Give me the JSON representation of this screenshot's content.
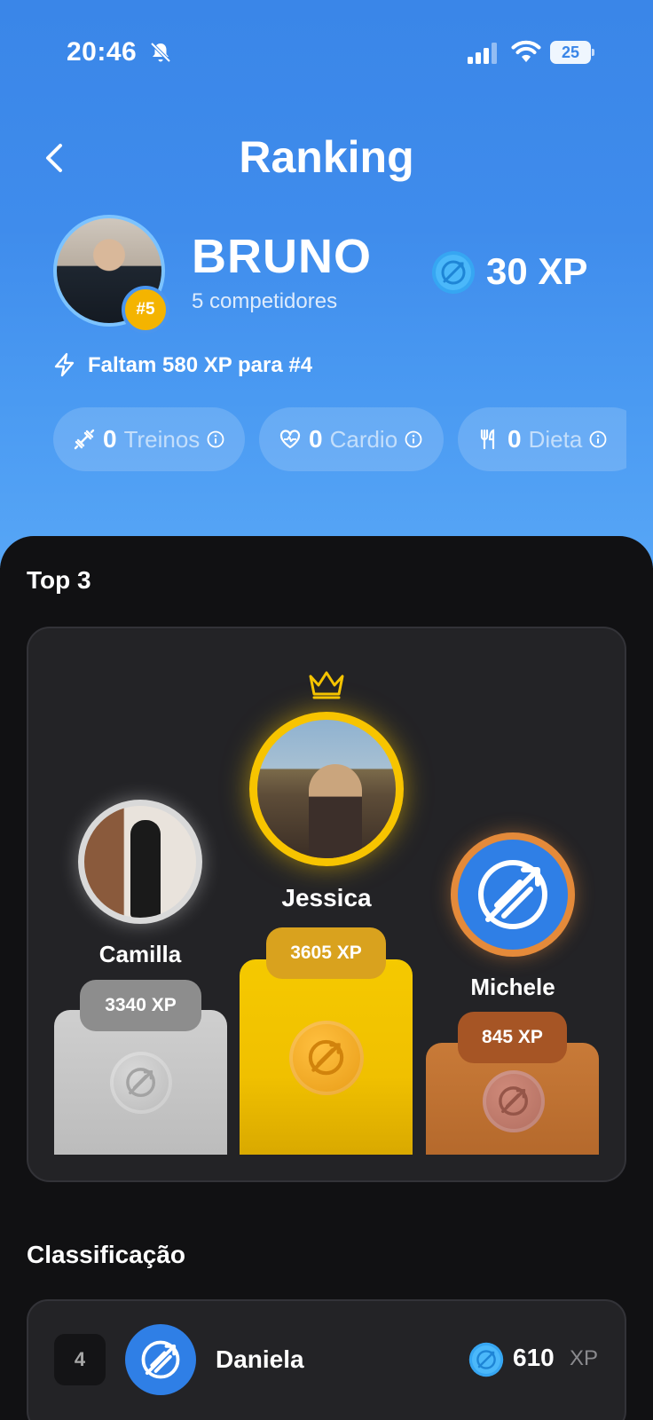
{
  "status_bar": {
    "time": "20:46",
    "battery": "25"
  },
  "header": {
    "title": "Ranking"
  },
  "user": {
    "name": "BRUNO",
    "rank_badge": "#5",
    "subtitle": "5 competidores",
    "xp_total": "30 XP",
    "next_goal": "Faltam 580 XP para #4"
  },
  "stats": [
    {
      "value": "0",
      "label": "Treinos",
      "icon": "dumbbell-icon"
    },
    {
      "value": "0",
      "label": "Cardio",
      "icon": "heart-pulse-icon"
    },
    {
      "value": "0",
      "label": "Dieta",
      "icon": "fork-knife-icon"
    }
  ],
  "top3": {
    "label": "Top 3",
    "first": {
      "name": "Jessica",
      "xp": "3605 XP"
    },
    "second": {
      "name": "Camilla",
      "xp": "3340 XP"
    },
    "third": {
      "name": "Michele",
      "xp": "845 XP"
    }
  },
  "classification": {
    "label": "Classificação",
    "rows": [
      {
        "position": "4",
        "name": "Daniela",
        "xp": "610",
        "unit": "XP"
      }
    ]
  },
  "colors": {
    "accent": "#3a86e8",
    "gold": "#f5c900",
    "silver": "#cfcfcf",
    "bronze": "#c87a38"
  }
}
